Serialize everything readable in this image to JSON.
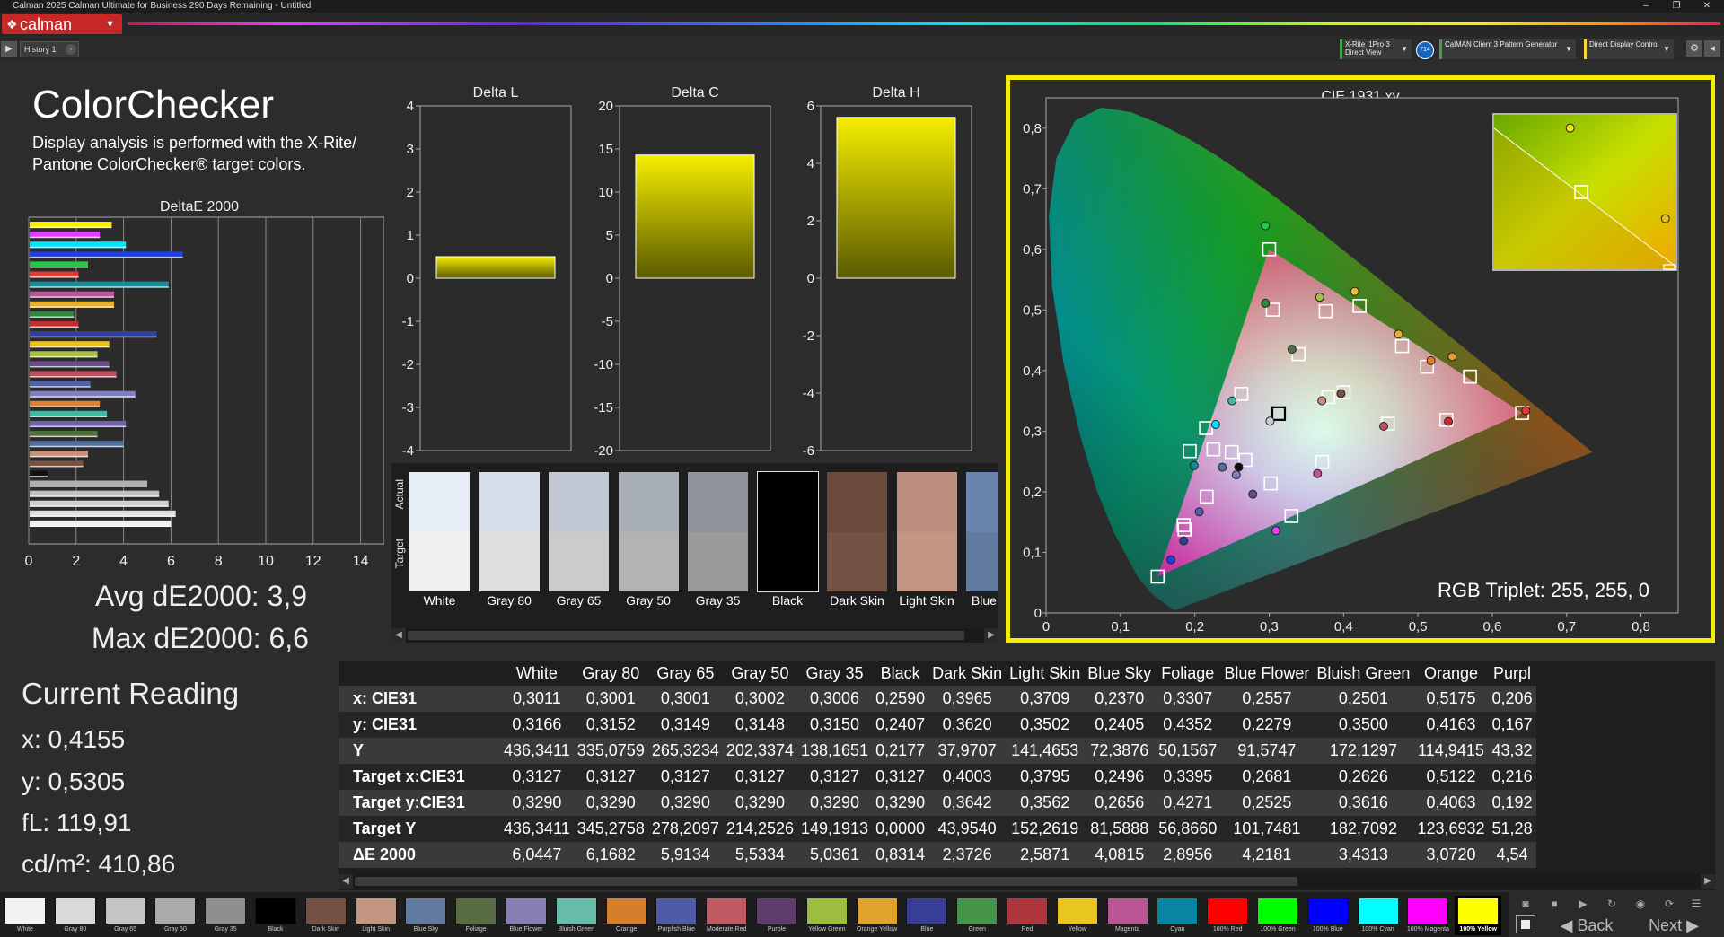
{
  "window": {
    "title": "Calman 2025 Calman Ultimate for Business 290 Days Remaining - Untitled",
    "minimize": "–",
    "restore": "❐",
    "close": "✕"
  },
  "app": {
    "logo_text": "calman"
  },
  "history": {
    "tab_label": "History 1"
  },
  "devices": {
    "meter_line1": "X-Rite i1Pro 3",
    "meter_line2": "Direct View",
    "meter_badge": "714",
    "pattern_generator": "CalMAN Client 3 Pattern Generator",
    "display_control": "Direct Display Control"
  },
  "page": {
    "title": "ColorChecker",
    "description": "Display analysis is performed with the X-Rite/ Pantone ColorChecker® target colors.",
    "deltae_title": "DeltaE 2000",
    "avg_de": "Avg dE2000: 3,9",
    "max_de": "Max dE2000: 6,6"
  },
  "current_reading": {
    "title": "Current Reading",
    "x": "x: 0,4155",
    "y": "y: 0,5305",
    "fl": "fL: 119,91",
    "cdm2": "cd/m²: 410,86"
  },
  "colors": {
    "accent_yellow": "#f5ee00",
    "brand_red": "#c62828",
    "panel_bg": "#2b2b2b"
  },
  "chart_data": [
    {
      "id": "deltae",
      "type": "bar",
      "title": "DeltaE 2000",
      "orientation": "horizontal",
      "xlim": [
        0,
        15
      ],
      "xticks": [
        "0",
        "2",
        "4",
        "6",
        "8",
        "10",
        "12",
        "14"
      ],
      "bars": [
        {
          "value": 3.5,
          "color": "#f5ee00"
        },
        {
          "value": 3.0,
          "color": "#e040fb"
        },
        {
          "value": 4.1,
          "color": "#00e5ff"
        },
        {
          "value": 6.5,
          "color": "#1e40e0"
        },
        {
          "value": 2.5,
          "color": "#22c84a"
        },
        {
          "value": 2.1,
          "color": "#e53935"
        },
        {
          "value": 5.9,
          "color": "#1a8a9a"
        },
        {
          "value": 3.6,
          "color": "#c0509a"
        },
        {
          "value": 3.6,
          "color": "#e8b030"
        },
        {
          "value": 1.9,
          "color": "#2a8a3a"
        },
        {
          "value": 2.1,
          "color": "#c03030"
        },
        {
          "value": 5.4,
          "color": "#3040a0"
        },
        {
          "value": 3.4,
          "color": "#e8c020"
        },
        {
          "value": 2.9,
          "color": "#a8c040"
        },
        {
          "value": 3.4,
          "color": "#6a4a8a"
        },
        {
          "value": 3.7,
          "color": "#c05060"
        },
        {
          "value": 2.6,
          "color": "#5060b0"
        },
        {
          "value": 4.5,
          "color": "#8080c0"
        },
        {
          "value": 3.0,
          "color": "#e08030"
        },
        {
          "value": 3.3,
          "color": "#40b8a0"
        },
        {
          "value": 4.1,
          "color": "#7060b0"
        },
        {
          "value": 2.9,
          "color": "#507040"
        },
        {
          "value": 4.0,
          "color": "#5070a0"
        },
        {
          "value": 2.5,
          "color": "#c8907a"
        },
        {
          "value": 2.3,
          "color": "#7a5040"
        },
        {
          "value": 0.8,
          "color": "#111111"
        },
        {
          "value": 5.0,
          "color": "#b0b0b0"
        },
        {
          "value": 5.5,
          "color": "#c0c0c0"
        },
        {
          "value": 5.9,
          "color": "#d0d0d0"
        },
        {
          "value": 6.2,
          "color": "#e0e0e0"
        },
        {
          "value": 6.0,
          "color": "#f0f0f0"
        }
      ]
    },
    {
      "id": "delta_l",
      "type": "bar",
      "title": "Delta L",
      "ylim": [
        -4,
        4
      ],
      "yticks": [
        "4",
        "3",
        "2",
        "1",
        "0",
        "-1",
        "-2",
        "-3",
        "-4"
      ],
      "value": 0.5,
      "color": "#f5ee00"
    },
    {
      "id": "delta_c",
      "type": "bar",
      "title": "Delta C",
      "ylim": [
        -20,
        20
      ],
      "yticks": [
        "20",
        "15",
        "10",
        "5",
        "0",
        "-5",
        "-10",
        "-15",
        "-20"
      ],
      "value": 14.3,
      "color": "#f5ee00"
    },
    {
      "id": "delta_h",
      "type": "bar",
      "title": "Delta H",
      "ylim": [
        -6,
        6
      ],
      "yticks": [
        "6",
        "4",
        "2",
        "0",
        "-2",
        "-4",
        "-6"
      ],
      "value": 5.6,
      "color": "#f5ee00"
    },
    {
      "id": "cie",
      "type": "scatter",
      "title": "CIE 1931 xy",
      "xlim": [
        0,
        0.85
      ],
      "ylim": [
        0,
        0.85
      ],
      "xticks": [
        "0",
        "0,1",
        "0,2",
        "0,3",
        "0,4",
        "0,5",
        "0,6",
        "0,7",
        "0,8"
      ],
      "yticks": [
        "0",
        "0,1",
        "0,2",
        "0,3",
        "0,4",
        "0,5",
        "0,6",
        "0,7",
        "0,8"
      ],
      "gamut_triangle": [
        [
          0.64,
          0.33
        ],
        [
          0.3,
          0.6
        ],
        [
          0.15,
          0.06
        ]
      ],
      "targets": [
        [
          0.64,
          0.33
        ],
        [
          0.3,
          0.6
        ],
        [
          0.15,
          0.06
        ],
        [
          0.3127,
          0.329
        ],
        [
          0.4003,
          0.3642
        ],
        [
          0.3795,
          0.3562
        ],
        [
          0.2496,
          0.2656
        ],
        [
          0.3395,
          0.4271
        ],
        [
          0.2681,
          0.2525
        ],
        [
          0.2626,
          0.3616
        ],
        [
          0.5122,
          0.4063
        ],
        [
          0.216,
          0.192
        ],
        [
          0.4596,
          0.3122
        ],
        [
          0.3021,
          0.2138
        ],
        [
          0.376,
          0.498
        ],
        [
          0.4787,
          0.4404
        ],
        [
          0.1862,
          0.1378
        ],
        [
          0.3048,
          0.5004
        ],
        [
          0.5382,
          0.3186
        ],
        [
          0.4215,
          0.5066
        ],
        [
          0.3714,
          0.2492
        ],
        [
          0.1932,
          0.267
        ],
        [
          0.215,
          0.305
        ],
        [
          0.185,
          0.145
        ],
        [
          0.57,
          0.39
        ],
        [
          0.33,
          0.16
        ],
        [
          0.225,
          0.27
        ]
      ],
      "measured": [
        {
          "x": 0.3011,
          "y": 0.3166,
          "color": "#cccccc"
        },
        {
          "x": 0.259,
          "y": 0.2407,
          "color": "#111111"
        },
        {
          "x": 0.3965,
          "y": 0.362,
          "color": "#7a5040"
        },
        {
          "x": 0.3709,
          "y": 0.3502,
          "color": "#c8907a"
        },
        {
          "x": 0.237,
          "y": 0.2405,
          "color": "#5070a0"
        },
        {
          "x": 0.3307,
          "y": 0.4352,
          "color": "#507040"
        },
        {
          "x": 0.2557,
          "y": 0.2279,
          "color": "#8080c0"
        },
        {
          "x": 0.2501,
          "y": 0.35,
          "color": "#40b8a0"
        },
        {
          "x": 0.5175,
          "y": 0.4163,
          "color": "#e08030"
        },
        {
          "x": 0.206,
          "y": 0.167,
          "color": "#5060b0"
        },
        {
          "x": 0.454,
          "y": 0.308,
          "color": "#c05060"
        },
        {
          "x": 0.278,
          "y": 0.196,
          "color": "#6a4a8a"
        },
        {
          "x": 0.368,
          "y": 0.521,
          "color": "#a8c040"
        },
        {
          "x": 0.474,
          "y": 0.46,
          "color": "#e8b030"
        },
        {
          "x": 0.185,
          "y": 0.119,
          "color": "#3040a0"
        },
        {
          "x": 0.295,
          "y": 0.511,
          "color": "#2a8a3a"
        },
        {
          "x": 0.541,
          "y": 0.316,
          "color": "#c03030"
        },
        {
          "x": 0.415,
          "y": 0.5305,
          "color": "#e8c020"
        },
        {
          "x": 0.365,
          "y": 0.23,
          "color": "#c0509a"
        },
        {
          "x": 0.199,
          "y": 0.243,
          "color": "#1a8a9a"
        },
        {
          "x": 0.645,
          "y": 0.334,
          "color": "#e53935"
        },
        {
          "x": 0.295,
          "y": 0.639,
          "color": "#22c84a"
        },
        {
          "x": 0.168,
          "y": 0.088,
          "color": "#1e40e0"
        },
        {
          "x": 0.228,
          "y": 0.311,
          "color": "#00e5ff"
        },
        {
          "x": 0.309,
          "y": 0.136,
          "color": "#e040fb"
        },
        {
          "x": 0.546,
          "y": 0.423,
          "color": "#e8a030"
        }
      ],
      "highlight_target": [
        0.3127,
        0.329
      ]
    }
  ],
  "swatch_strip": {
    "label_actual": "Actual",
    "label_target": "Target",
    "items": [
      {
        "label": "White",
        "actual": "#e8eef8",
        "target": "#efefef"
      },
      {
        "label": "Gray 80",
        "actual": "#d6dde8",
        "target": "#dedede"
      },
      {
        "label": "Gray 65",
        "actual": "#c2c8d4",
        "target": "#cbcbcb"
      },
      {
        "label": "Gray 50",
        "actual": "#a9afb9",
        "target": "#b3b3b3"
      },
      {
        "label": "Gray 35",
        "actual": "#8f949c",
        "target": "#9a9a9a"
      },
      {
        "label": "Black",
        "actual": "#000000",
        "target": "#000000"
      },
      {
        "label": "Dark Skin",
        "actual": "#6b4a3c",
        "target": "#735244"
      },
      {
        "label": "Light Skin",
        "actual": "#be8e7e",
        "target": "#c29682"
      },
      {
        "label": "Blue Sky",
        "actual": "#6a84b0",
        "target": "#627a9d"
      }
    ]
  },
  "table": {
    "columns": [
      "White",
      "Gray 80",
      "Gray 65",
      "Gray 50",
      "Gray 35",
      "Black",
      "Dark Skin",
      "Light Skin",
      "Blue Sky",
      "Foliage",
      "Blue Flower",
      "Bluish Green",
      "Orange",
      "Purpl"
    ],
    "rows": [
      {
        "label": "x: CIE31",
        "values": [
          "0,3011",
          "0,3001",
          "0,3001",
          "0,3002",
          "0,3006",
          "0,2590",
          "0,3965",
          "0,3709",
          "0,2370",
          "0,3307",
          "0,2557",
          "0,2501",
          "0,5175",
          "0,206"
        ]
      },
      {
        "label": "y: CIE31",
        "values": [
          "0,3166",
          "0,3152",
          "0,3149",
          "0,3148",
          "0,3150",
          "0,2407",
          "0,3620",
          "0,3502",
          "0,2405",
          "0,4352",
          "0,2279",
          "0,3500",
          "0,4163",
          "0,167"
        ]
      },
      {
        "label": "Y",
        "values": [
          "436,3411",
          "335,0759",
          "265,3234",
          "202,3374",
          "138,1651",
          "0,2177",
          "37,9707",
          "141,4653",
          "72,3876",
          "50,1567",
          "91,5747",
          "172,1297",
          "114,9415",
          "43,32"
        ]
      },
      {
        "label": "Target x:CIE31",
        "values": [
          "0,3127",
          "0,3127",
          "0,3127",
          "0,3127",
          "0,3127",
          "0,3127",
          "0,4003",
          "0,3795",
          "0,2496",
          "0,3395",
          "0,2681",
          "0,2626",
          "0,5122",
          "0,216"
        ]
      },
      {
        "label": "Target y:CIE31",
        "values": [
          "0,3290",
          "0,3290",
          "0,3290",
          "0,3290",
          "0,3290",
          "0,3290",
          "0,3642",
          "0,3562",
          "0,2656",
          "0,4271",
          "0,2525",
          "0,3616",
          "0,4063",
          "0,192"
        ]
      },
      {
        "label": "Target Y",
        "values": [
          "436,3411",
          "345,2758",
          "278,2097",
          "214,2526",
          "149,1913",
          "0,0000",
          "43,9540",
          "152,2619",
          "81,5888",
          "56,8660",
          "101,7481",
          "182,7092",
          "123,6932",
          "51,28"
        ]
      },
      {
        "label": "ΔE 2000",
        "values": [
          "6,0447",
          "6,1682",
          "5,9134",
          "5,5334",
          "5,0361",
          "0,8314",
          "2,3726",
          "2,5871",
          "4,0815",
          "2,8956",
          "4,2181",
          "3,4313",
          "3,0720",
          "4,54"
        ]
      }
    ]
  },
  "bottom_strip": {
    "items": [
      {
        "label": "White",
        "color": "#f2f2f2"
      },
      {
        "label": "Gray 80",
        "color": "#d9d9d9"
      },
      {
        "label": "Gray 65",
        "color": "#c4c4c4"
      },
      {
        "label": "Gray 50",
        "color": "#aaaaaa"
      },
      {
        "label": "Gray 35",
        "color": "#8f8f8f"
      },
      {
        "label": "Black",
        "color": "#000000"
      },
      {
        "label": "Dark Skin",
        "color": "#735244"
      },
      {
        "label": "Light Skin",
        "color": "#c29682"
      },
      {
        "label": "Blue Sky",
        "color": "#627a9d"
      },
      {
        "label": "Foliage",
        "color": "#576c43"
      },
      {
        "label": "Blue Flower",
        "color": "#8580b1"
      },
      {
        "label": "Bluish Green",
        "color": "#67bdaa"
      },
      {
        "label": "Orange",
        "color": "#d67e2c"
      },
      {
        "label": "Purplish Blue",
        "color": "#505ba6"
      },
      {
        "label": "Moderate Red",
        "color": "#c15a63"
      },
      {
        "label": "Purple",
        "color": "#5e3c6c"
      },
      {
        "label": "Yellow Green",
        "color": "#9dbc40"
      },
      {
        "label": "Orange Yellow",
        "color": "#e0a32e"
      },
      {
        "label": "Blue",
        "color": "#383d96"
      },
      {
        "label": "Green",
        "color": "#469449"
      },
      {
        "label": "Red",
        "color": "#af363c"
      },
      {
        "label": "Yellow",
        "color": "#e7c71f"
      },
      {
        "label": "Magenta",
        "color": "#bb5695"
      },
      {
        "label": "Cyan",
        "color": "#0885a1"
      },
      {
        "label": "100% Red",
        "color": "#ff0000"
      },
      {
        "label": "100% Green",
        "color": "#00ff00"
      },
      {
        "label": "100% Blue",
        "color": "#0000ff"
      },
      {
        "label": "100% Cyan",
        "color": "#00ffff"
      },
      {
        "label": "100% Magenta",
        "color": "#ff00ff"
      },
      {
        "label": "100% Yellow",
        "color": "#ffff00"
      }
    ],
    "selected_index": 29
  },
  "cie": {
    "rgb_triplet": "RGB Triplet: 255, 255, 0"
  },
  "nav": {
    "back": "Back",
    "next": "Next"
  }
}
